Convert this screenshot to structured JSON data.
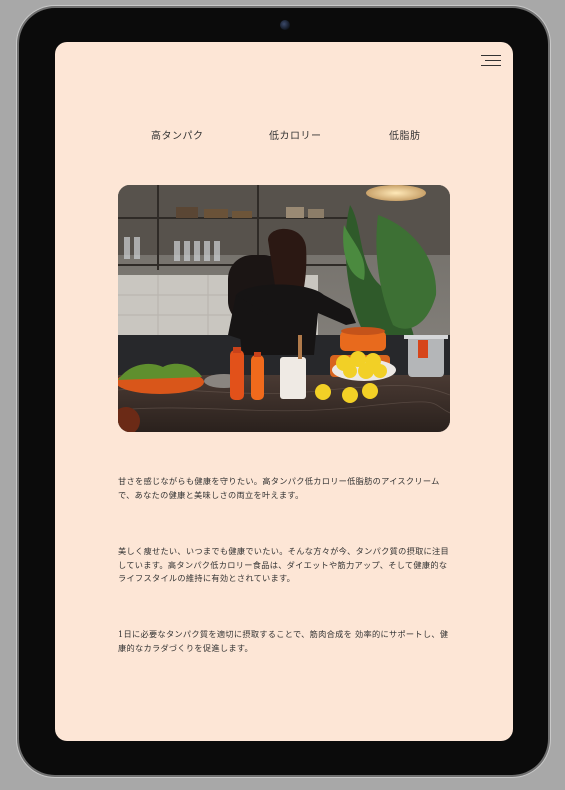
{
  "menu": {
    "icon": "hamburger-menu-icon"
  },
  "tabs": [
    {
      "label": "高タンパク"
    },
    {
      "label": "低カロリー"
    },
    {
      "label": "低脂肪"
    }
  ],
  "hero": {
    "icon": "kitchen-photo"
  },
  "paragraphs": [
    {
      "text": "甘さを感じながらも健康を守りたい。高タンパク低カロリー低脂肪のアイスクリームで、あなたの健康と美味しさの両立を叶えます。"
    },
    {
      "text": "美しく痩せたい、いつまでも健康でいたい。そんな方々が今、タンパク質の摂取に注目しています。高タンパク低カロリー食品は、ダイエットや筋力アップ、そして健康的なライフスタイルの維持に有効とされています。"
    },
    {
      "text": "1日に必要なタンパク質を適切に摂取することで、筋肉合成を 効率的にサポートし、健康的なカラダづくりを促進します。"
    }
  ],
  "colors": {
    "screen_background": "#fde6d6",
    "device_frame": "#0b0b0b",
    "text": "#333333"
  }
}
